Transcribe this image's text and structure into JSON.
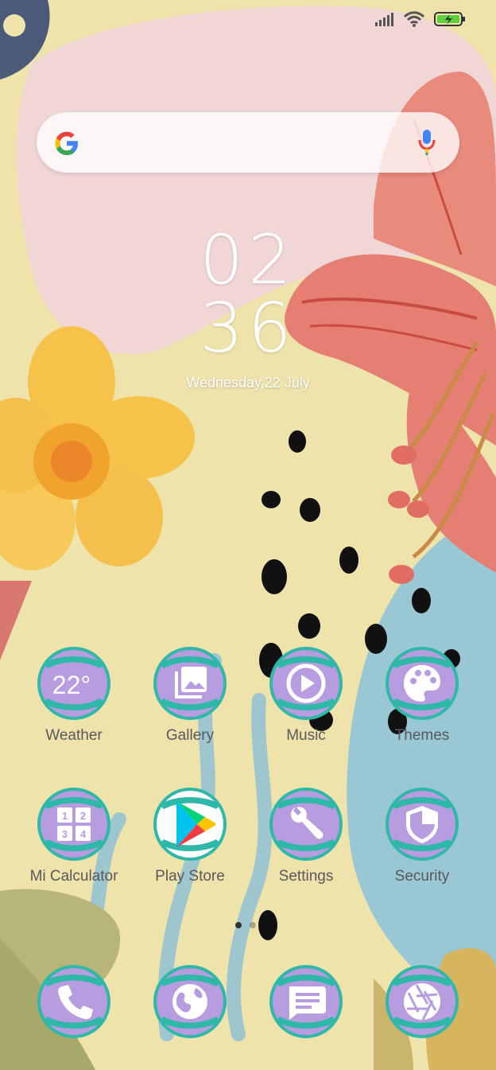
{
  "status_bar": {
    "signal_icon": "signal-bars-icon",
    "wifi_icon": "wifi-icon",
    "battery_icon": "battery-charging-icon",
    "battery_color": "#5ccf3a"
  },
  "search": {
    "logo_icon": "google-g-icon",
    "mic_icon": "microphone-icon"
  },
  "clock": {
    "hours": "02",
    "minutes": "36",
    "date": "Wednesday,22 July"
  },
  "apps_row1": [
    {
      "label": "Weather",
      "icon": "weather-icon",
      "text": "22°"
    },
    {
      "label": "Gallery",
      "icon": "gallery-icon"
    },
    {
      "label": "Music",
      "icon": "music-play-icon"
    },
    {
      "label": "Themes",
      "icon": "palette-icon"
    }
  ],
  "apps_row2": [
    {
      "label": "Mi Calculator",
      "icon": "calculator-icon",
      "digits": [
        "1",
        "2",
        "3",
        "4"
      ]
    },
    {
      "label": "Play Store",
      "icon": "play-store-icon"
    },
    {
      "label": "Settings",
      "icon": "wrench-icon"
    },
    {
      "label": "Security",
      "icon": "shield-icon"
    }
  ],
  "dock": [
    {
      "icon": "phone-icon"
    },
    {
      "icon": "browser-globe-icon"
    },
    {
      "icon": "messages-icon"
    },
    {
      "icon": "camera-aperture-icon"
    }
  ],
  "page_indicator": {
    "count": 2,
    "active": 1
  },
  "colors": {
    "icon_purple": "#b79ce0",
    "icon_teal_ring": "#2fb8a8",
    "wallpaper_cream": "#efe3ac",
    "wallpaper_pink": "#f1d6d6",
    "wallpaper_blue": "#99c7d4"
  }
}
